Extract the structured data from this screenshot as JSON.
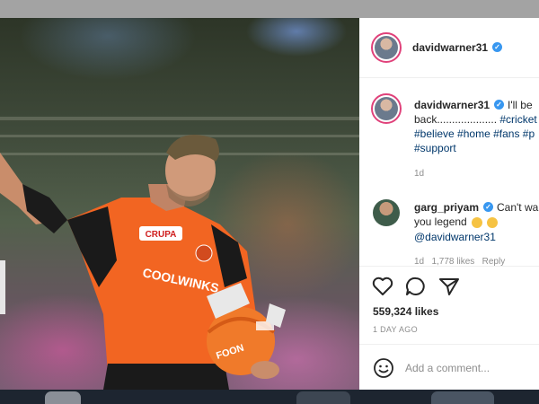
{
  "post": {
    "username": "davidwarner31",
    "verified": true,
    "caption": {
      "line1_text": "I'll be",
      "line2_text": "back....................",
      "line2_tag": "#cricket",
      "line3_tags": [
        "#believe",
        "#home",
        "#fans",
        "#p"
      ],
      "line4_tag": "#support",
      "time": "1d"
    },
    "comment": {
      "username": "garg_priyam",
      "verified": true,
      "line1_text": "Can't wa",
      "line2_text": "you legend",
      "line3_mention": "@davidwarner31",
      "time": "1d",
      "likes": "1,778 likes",
      "reply": "Reply"
    },
    "likes": "559,324 likes",
    "date": "1 DAY AGO",
    "comment_placeholder": "Add a comment..."
  },
  "photo": {
    "jersey_text_1": "CRUPA",
    "jersey_text_2": "COOLWINKS",
    "helmet_text": "FOON",
    "colors": {
      "jersey": "#f26522",
      "jersey_dark": "#1a1a1a",
      "accent": "#e0417a",
      "link": "#00376b",
      "verified": "#3897f0"
    }
  },
  "icons": [
    "heart-icon",
    "comment-icon",
    "share-icon",
    "emoji-icon",
    "verified-icon"
  ]
}
